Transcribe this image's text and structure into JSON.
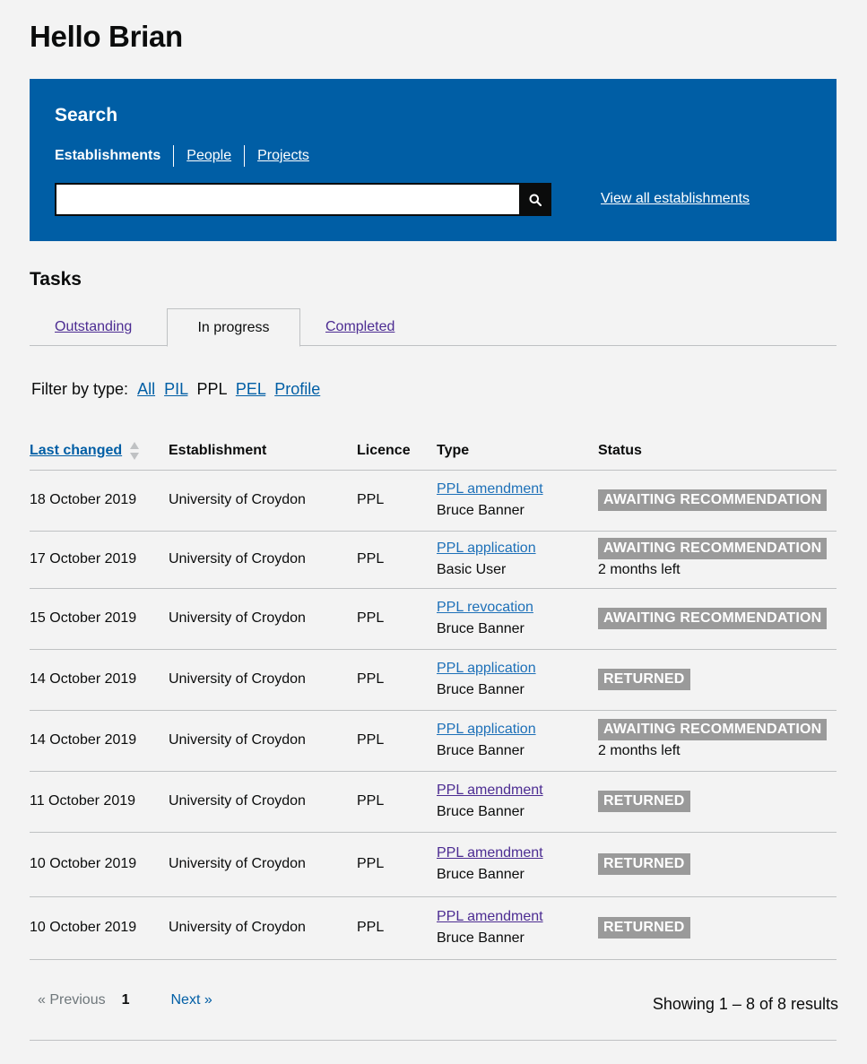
{
  "greeting": "Hello Brian",
  "search": {
    "heading": "Search",
    "tabs": [
      "Establishments",
      "People",
      "Projects"
    ],
    "input_value": "",
    "view_all_label": "View all establishments"
  },
  "tasks": {
    "heading": "Tasks",
    "tabs": [
      "Outstanding",
      "In progress",
      "Completed"
    ],
    "active_tab": "In progress",
    "filter_label": "Filter by type:",
    "filter_options": [
      "All",
      "PIL",
      "PPL",
      "PEL",
      "Profile"
    ],
    "filter_selected": "PPL",
    "columns": [
      "Last changed",
      "Establishment",
      "Licence",
      "Type",
      "Status"
    ],
    "rows": [
      {
        "date": "18 October 2019",
        "establishment": "University of Croydon",
        "licence": "PPL",
        "type": "PPL amendment",
        "person": "Bruce Banner",
        "status": "AWAITING RECOMMENDATION",
        "note": ""
      },
      {
        "date": "17 October 2019",
        "establishment": "University of Croydon",
        "licence": "PPL",
        "type": "PPL application",
        "person": "Basic User",
        "status": "AWAITING RECOMMENDATION",
        "note": "2 months left"
      },
      {
        "date": "15 October 2019",
        "establishment": "University of Croydon",
        "licence": "PPL",
        "type": "PPL revocation",
        "person": "Bruce Banner",
        "status": "AWAITING RECOMMENDATION",
        "note": ""
      },
      {
        "date": "14 October 2019",
        "establishment": "University of Croydon",
        "licence": "PPL",
        "type": "PPL application",
        "person": "Bruce Banner",
        "status": "RETURNED",
        "note": ""
      },
      {
        "date": "14 October 2019",
        "establishment": "University of Croydon",
        "licence": "PPL",
        "type": "PPL application",
        "person": "Bruce Banner",
        "status": "AWAITING RECOMMENDATION",
        "note": "2 months left"
      },
      {
        "date": "11 October 2019",
        "establishment": "University of Croydon",
        "licence": "PPL",
        "type": "PPL amendment",
        "person": "Bruce Banner",
        "status": "RETURNED",
        "note": ""
      },
      {
        "date": "10 October 2019",
        "establishment": "University of Croydon",
        "licence": "PPL",
        "type": "PPL amendment",
        "person": "Bruce Banner",
        "status": "RETURNED",
        "note": ""
      },
      {
        "date": "10 October 2019",
        "establishment": "University of Croydon",
        "licence": "PPL",
        "type": "PPL amendment",
        "person": "Bruce Banner",
        "status": "RETURNED",
        "note": ""
      }
    ]
  },
  "pagination": {
    "previous_label": "« Previous",
    "current_page": "1",
    "next_label": "Next »",
    "results_text": "Showing 1 – 8 of 8 results"
  },
  "colors": {
    "search_panel": "#005ea5",
    "link": "#005ea5",
    "visited_link": "#4c2c92",
    "badge": "#9a9a9a"
  },
  "icons": {
    "search": "search-icon",
    "sort": "sort-icon"
  }
}
